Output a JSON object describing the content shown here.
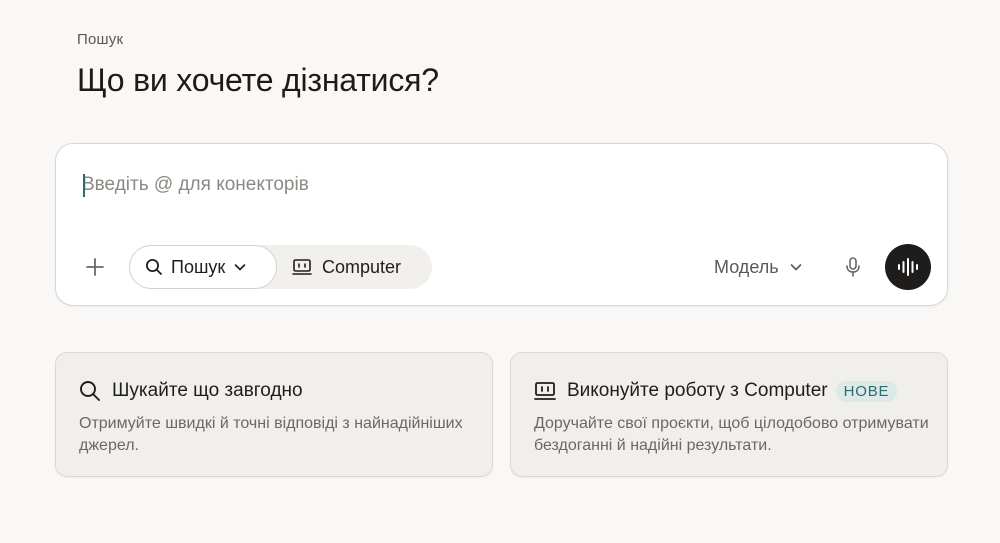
{
  "breadcrumb": "Пошук",
  "page_title": "Що ви хочете дізнатися?",
  "composer": {
    "placeholder": "Введіть @ для конекторів",
    "value": "",
    "add_icon": "plus-icon",
    "modes": [
      {
        "label": "Пошук",
        "icon": "search-icon",
        "selected": true,
        "has_dropdown": true
      },
      {
        "label": "Computer",
        "icon": "computer-icon",
        "selected": false
      }
    ],
    "model_label": "Модель",
    "mic_icon": "microphone-icon",
    "voice_icon": "voice-waveform-icon"
  },
  "cards": [
    {
      "icon": "search-icon",
      "title": "Шукайте що завгодно",
      "description": "Отримуйте швидкі й точні відповіді з найнадійніших джерел."
    },
    {
      "icon": "computer-icon",
      "title": "Виконуйте роботу з Computer",
      "badge": "НОВЕ",
      "description": "Доручайте свої проєкти, щоб цілодобово отримувати бездоганні й надійні результати."
    }
  ],
  "colors": {
    "background": "#faf8f6",
    "accent": "#2c6b70",
    "badge_bg": "#dce9e7",
    "voice_button": "#1e1d1b"
  }
}
